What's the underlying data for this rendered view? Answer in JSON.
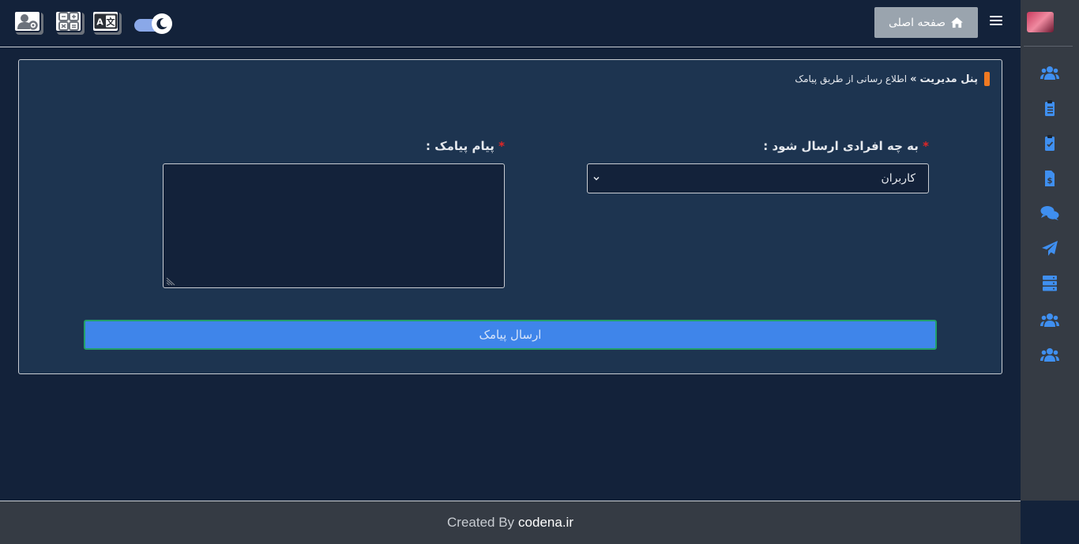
{
  "header": {
    "home_label": "صفحه اصلی",
    "home_icon": "home-icon",
    "menu_icon": "hamburger-icon",
    "theme_toggle_icon": "moon-icon",
    "tools": [
      "user-settings-icon",
      "calculator-icon",
      "translate-icon"
    ]
  },
  "breadcrumb": {
    "root": "پنل مدیریت",
    "separator": "»",
    "current": "اطلاع رسانی از طریق پیامک"
  },
  "form": {
    "recipients_label": "به چه افرادی ارسال شود :",
    "recipients_value": "کاربران",
    "message_label": "پیام پیامک :",
    "required_mark": "*",
    "submit_label": "ارسال پیامک"
  },
  "sidebar": {
    "items": [
      "users-icon",
      "clipboard-list-icon",
      "clipboard-check-icon",
      "invoice-dollar-icon",
      "comments-icon",
      "paper-plane-icon",
      "server-icon",
      "users-group-icon",
      "users-alt-icon"
    ]
  },
  "footer": {
    "prefix": "Created By",
    "brand": "codena.ir"
  },
  "colors": {
    "background": "#13223a",
    "card": "#1d3450",
    "sidebar": "#353b44",
    "accent_blue": "#3f85ea",
    "breadcrumb_marker": "#f07a22",
    "required_star": "#e02626"
  }
}
